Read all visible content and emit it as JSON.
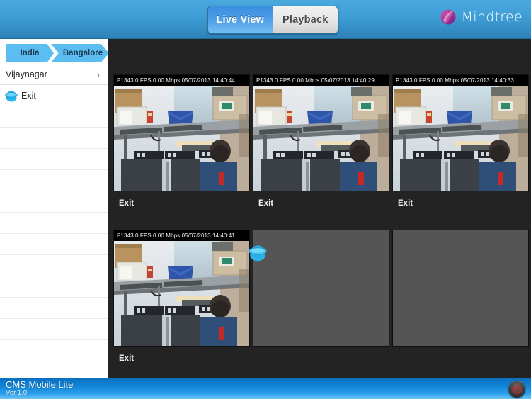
{
  "header": {
    "tabs": [
      {
        "label": "Live View",
        "active": true
      },
      {
        "label": "Playback",
        "active": false
      }
    ],
    "brand": {
      "name": "Mindtree",
      "logo_icon": "mindtree-spiral-icon",
      "color": "#a8338f"
    }
  },
  "sidebar": {
    "breadcrumbs": [
      {
        "label": "India"
      },
      {
        "label": "Bangalore"
      }
    ],
    "nodes": [
      {
        "label": "Vijaynagar",
        "chevron": "›",
        "type": "group"
      }
    ],
    "cameras": [
      {
        "label": "Exit",
        "icon": "dome-camera-icon"
      }
    ],
    "empty_row_count": 12
  },
  "main": {
    "tiles": [
      {
        "osd": "P1343  0 FPS  0.00 Mbps 05/07/2013 14:40:44",
        "camera_id": "P1343",
        "fps": "0 FPS",
        "bitrate": "0.00 Mbps",
        "date": "05/07/2013",
        "time": "14:40:44",
        "caption": "Exit",
        "state": "live"
      },
      {
        "osd": "P1343  0 FPS  0.00 Mbps 05/07/2013 14:40:29",
        "camera_id": "P1343",
        "fps": "0 FPS",
        "bitrate": "0.00 Mbps",
        "date": "05/07/2013",
        "time": "14:40:29",
        "caption": "Exit",
        "state": "live"
      },
      {
        "osd": "P1343  0 FPS  0.00 Mbps 05/07/2013 14:40:33",
        "camera_id": "P1343",
        "fps": "0 FPS",
        "bitrate": "0.00 Mbps",
        "date": "05/07/2013",
        "time": "14:40:33",
        "caption": "Exit",
        "state": "live"
      },
      {
        "osd": "P1343  0 FPS  0.00 Mbps 05/07/2013 14:40:41",
        "camera_id": "P1343",
        "fps": "0 FPS",
        "bitrate": "0.00 Mbps",
        "date": "05/07/2013",
        "time": "14:40:41",
        "caption": "Exit",
        "state": "live"
      },
      {
        "osd": "",
        "caption": "",
        "state": "empty"
      },
      {
        "osd": "",
        "caption": "",
        "state": "empty"
      }
    ],
    "drag_ghost": {
      "icon": "dome-camera-icon",
      "visible": true
    }
  },
  "footer": {
    "title": "CMS Mobile Lite",
    "version": "Ver 1.0",
    "power_icon": "power-icon",
    "power_color": "#cc2222"
  },
  "colors": {
    "header_blue": "#3e9ed6",
    "accent_cyan": "#29b6e8",
    "crumb_blue": "#5bbdf0",
    "footer_blue": "#1386d8",
    "panel_dark": "#232323",
    "empty_tile": "#555555"
  }
}
